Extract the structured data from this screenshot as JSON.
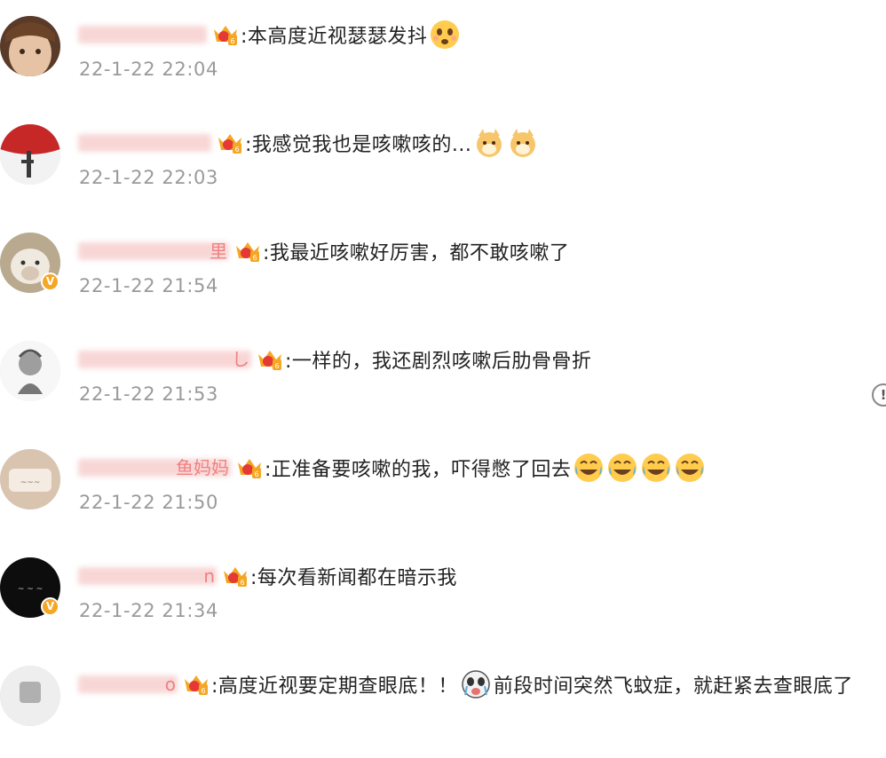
{
  "comments": [
    {
      "username_tail": "",
      "text": ":本高度近视瑟瑟发抖",
      "time": "22-1-22 22:04",
      "emojis": [
        "shiver-face"
      ],
      "verified": false,
      "avatar_colors": [
        "#d9b89a",
        "#6b4a34"
      ]
    },
    {
      "username_tail": "",
      "text": ":我感觉我也是咳嗽咳的...",
      "time": "22-1-22 22:03",
      "emojis": [
        "shiba-dog",
        "shiba-dog"
      ],
      "verified": false,
      "avatar_colors": [
        "#c62828",
        "#ffffff"
      ]
    },
    {
      "username_tail": "里",
      "text": ":我最近咳嗽好厉害，都不敢咳嗽了",
      "time": "22-1-22 21:54",
      "emojis": [],
      "verified": true,
      "avatar_colors": [
        "#e8e1d6",
        "#7b6a5a"
      ]
    },
    {
      "username_tail": "し",
      "text": ":一样的，我还剧烈咳嗽后肋骨骨折",
      "time": "22-1-22 21:53",
      "emojis": [],
      "verified": false,
      "avatar_colors": [
        "#f0f0f0",
        "#555555"
      ]
    },
    {
      "username_tail": "鱼妈妈",
      "text": ":正准备要咳嗽的我，吓得憋了回去",
      "time": "22-1-22 21:50",
      "emojis": [
        "laugh-cry",
        "laugh-cry",
        "laugh-cry",
        "laugh-cry"
      ],
      "verified": false,
      "avatar_colors": [
        "#d7c0b0",
        "#8a6a55"
      ]
    },
    {
      "username_tail": "n",
      "text": ":每次看新闻都在暗示我",
      "time": "22-1-22 21:34",
      "emojis": [],
      "verified": true,
      "avatar_colors": [
        "#111111",
        "#dddddd"
      ]
    },
    {
      "username_tail": "o",
      "text": ":高度近视要定期查眼底！！",
      "text2": "前段时间突然飞蚊症，就赶紧去查眼底了",
      "time": "",
      "emojis": [
        "panda-cry"
      ],
      "verified": false,
      "avatar_colors": [
        "#e6e6e6",
        "#999999"
      ]
    }
  ],
  "colors": {
    "time": "#9a9a9a",
    "text": "#222222",
    "crown": "#f5a623",
    "badge": "#f5a623"
  },
  "side_icon": "!"
}
